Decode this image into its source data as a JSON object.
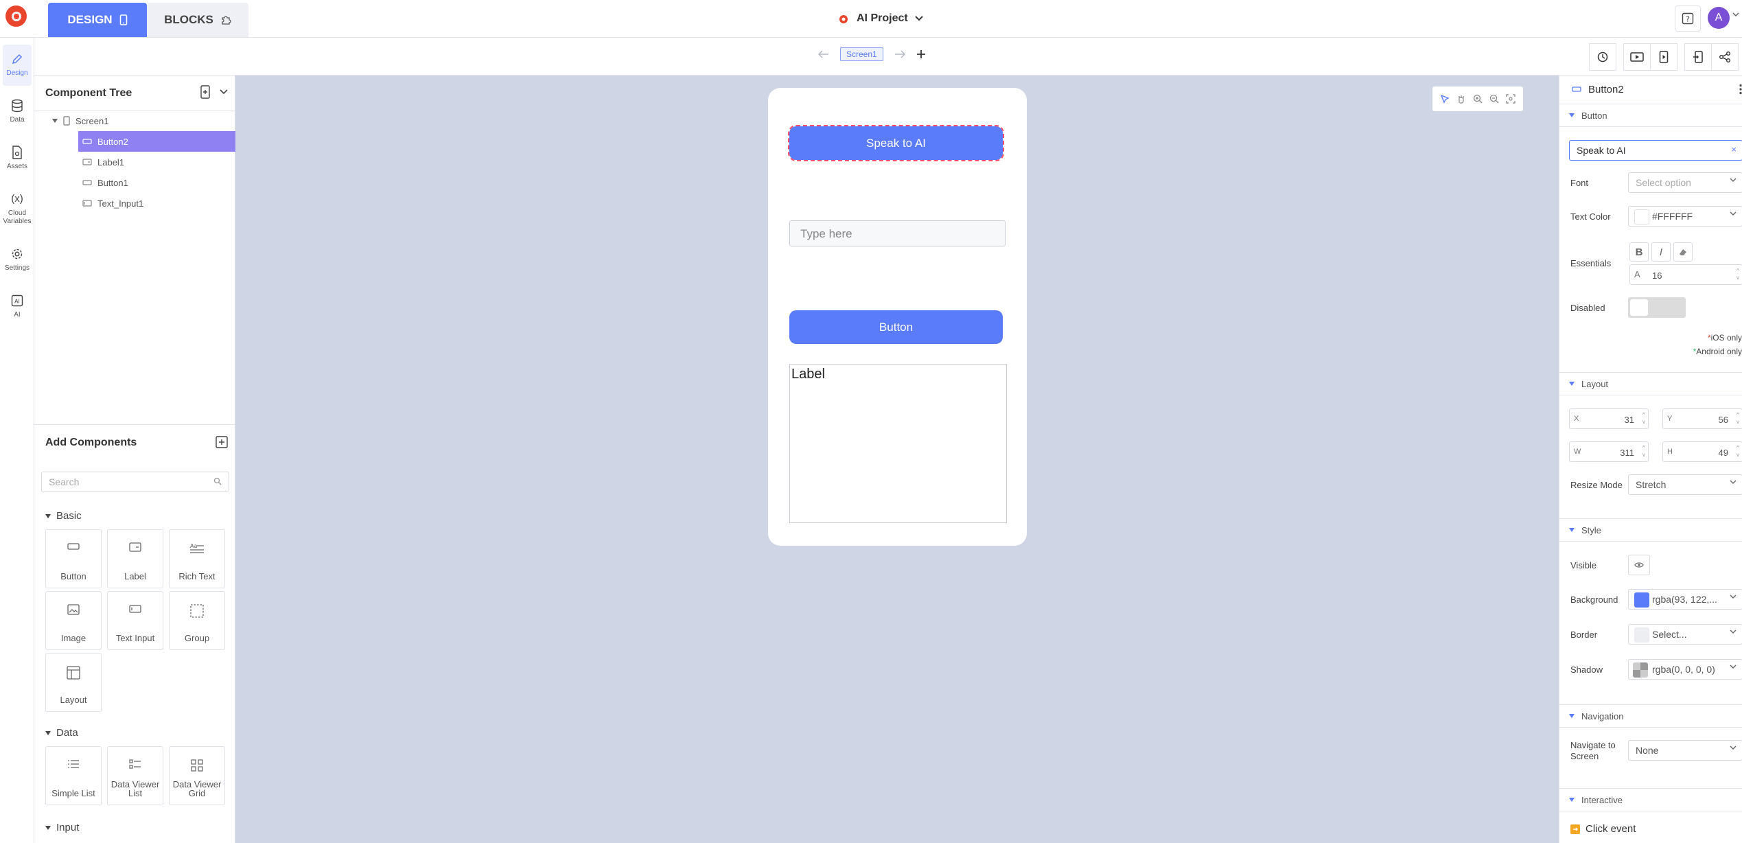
{
  "topbar": {
    "design_tab": "DESIGN",
    "blocks_tab": "BLOCKS",
    "project_name": "AI Project",
    "avatar_initial": "A"
  },
  "subbar": {
    "current_screen": "Screen1"
  },
  "rail": [
    {
      "label": "Design",
      "icon": "pencil-icon"
    },
    {
      "label": "Data",
      "icon": "database-icon"
    },
    {
      "label": "Assets",
      "icon": "file-icon"
    },
    {
      "label": "Cloud Variables",
      "icon": "variable-icon"
    },
    {
      "label": "Settings",
      "icon": "gear-icon"
    },
    {
      "label": "AI",
      "icon": "ai-icon"
    }
  ],
  "component_tree": {
    "title": "Component Tree",
    "items": [
      {
        "label": "Screen1"
      },
      {
        "label": "Button2"
      },
      {
        "label": "Label1"
      },
      {
        "label": "Button1"
      },
      {
        "label": "Text_Input1"
      }
    ]
  },
  "add_components": {
    "title": "Add Components",
    "search_placeholder": "Search",
    "categories": {
      "basic": "Basic",
      "data": "Data",
      "input": "Input"
    },
    "basic_items": [
      "Button",
      "Label",
      "Rich Text",
      "Image",
      "Text Input",
      "Group",
      "Layout"
    ],
    "data_items": [
      "Simple List",
      "Data Viewer List",
      "Data Viewer Grid"
    ]
  },
  "phone": {
    "button2_text": "Speak to AI",
    "textinput_placeholder": "Type here",
    "button1_text": "Button",
    "label1_text": "Label"
  },
  "props": {
    "component_name": "Button2",
    "sections": {
      "button": "Button",
      "layout": "Layout",
      "style": "Style",
      "navigation": "Navigation",
      "interactive": "Interactive"
    },
    "text_value": "Speak to AI",
    "font_label": "Font",
    "font_placeholder": "Select option",
    "text_color_label": "Text Color",
    "text_color_value": "#FFFFFF",
    "essentials_label": "Essentials",
    "bold": "B",
    "italic": "I",
    "font_size": "16",
    "disabled_label": "Disabled",
    "ios_only": "iOS only",
    "android_only": "Android only",
    "x_key": "X",
    "x_val": "31",
    "y_key": "Y",
    "y_val": "56",
    "w_key": "W",
    "w_val": "311",
    "h_key": "H",
    "h_val": "49",
    "resize_mode_label": "Resize Mode",
    "resize_mode_value": "Stretch",
    "visible_label": "Visible",
    "background_label": "Background",
    "background_value": "rgba(93, 122,...",
    "border_label": "Border",
    "border_value": "Select...",
    "shadow_label": "Shadow",
    "shadow_value": "rgba(0, 0, 0, 0)",
    "navigate_label": "Navigate to Screen",
    "navigate_value": "None",
    "click_event": "Click event"
  },
  "colors": {
    "accent": "#5b7cfa",
    "selection": "#8f81f2",
    "canvas": "#cfd5e5",
    "logo": "#e8452c"
  }
}
